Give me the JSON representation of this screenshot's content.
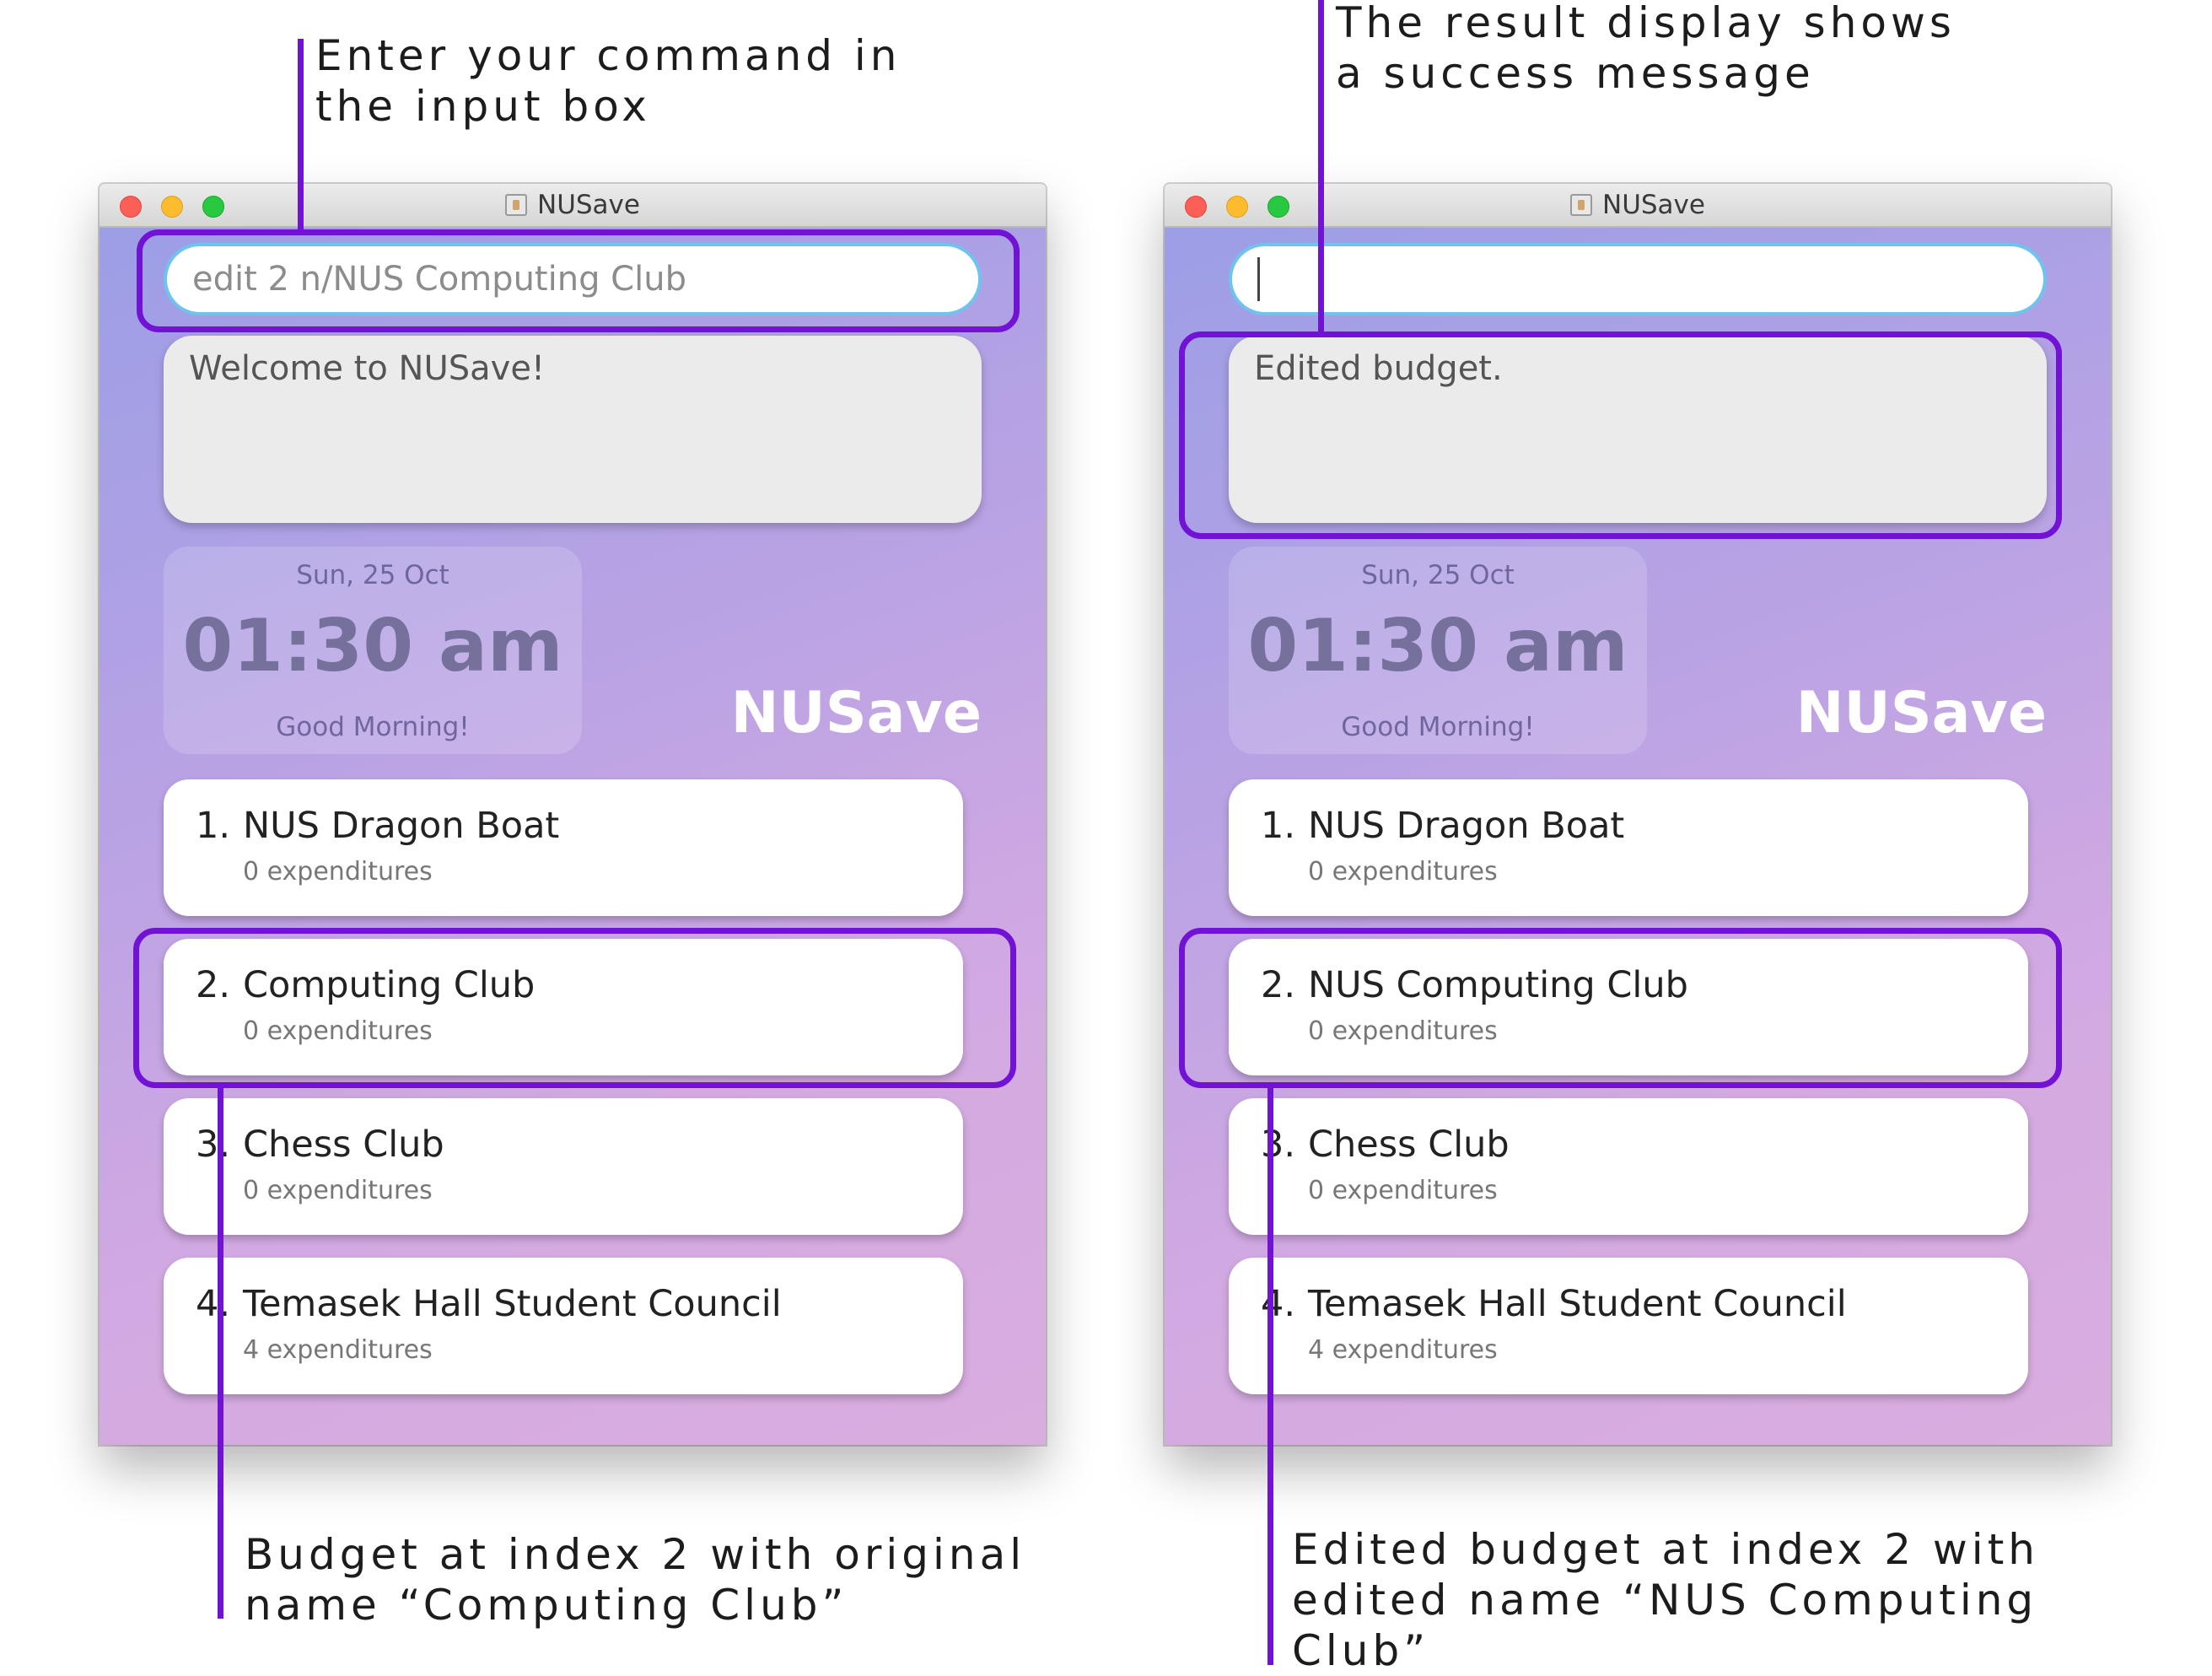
{
  "left_window": {
    "title": "NUSave",
    "command_input": "edit 2 n/NUS Computing Club",
    "result_text": "Welcome to NUSave!",
    "clock": {
      "date": "Sun, 25 Oct",
      "time": "01:30 am",
      "greeting": "Good Morning!"
    },
    "brand": "NUSave",
    "budgets": [
      {
        "index": "1.",
        "name": "NUS Dragon Boat",
        "expenditures": "0 expenditures"
      },
      {
        "index": "2.",
        "name": "Computing Club",
        "expenditures": "0 expenditures"
      },
      {
        "index": "3.",
        "name": "Chess Club",
        "expenditures": "0 expenditures"
      },
      {
        "index": "4.",
        "name": "Temasek Hall Student Council",
        "expenditures": "4 expenditures"
      }
    ]
  },
  "right_window": {
    "title": "NUSave",
    "command_input": "",
    "result_text": "Edited budget.",
    "clock": {
      "date": "Sun, 25 Oct",
      "time": "01:30 am",
      "greeting": "Good Morning!"
    },
    "brand": "NUSave",
    "budgets": [
      {
        "index": "1.",
        "name": "NUS Dragon Boat",
        "expenditures": "0 expenditures"
      },
      {
        "index": "2.",
        "name": "NUS Computing Club",
        "expenditures": "0 expenditures"
      },
      {
        "index": "3.",
        "name": "Chess Club",
        "expenditures": "0 expenditures"
      },
      {
        "index": "4.",
        "name": "Temasek Hall Student Council",
        "expenditures": "4 expenditures"
      }
    ]
  },
  "annotations": {
    "input_box_line1": "Enter your command in",
    "input_box_line2": "the input box",
    "result_line1": "The result display shows",
    "result_line2": "a success message",
    "original_line1": "Budget at index 2 with original",
    "original_line2": "name “Computing Club”",
    "edited_line1": "Edited budget at index 2 with",
    "edited_line2": "edited name “NUS Computing",
    "edited_line3": "Club”"
  },
  "colors": {
    "highlight": "#7212d4",
    "input_border": "#6ec3ef",
    "brand_text": "#ffffff"
  }
}
